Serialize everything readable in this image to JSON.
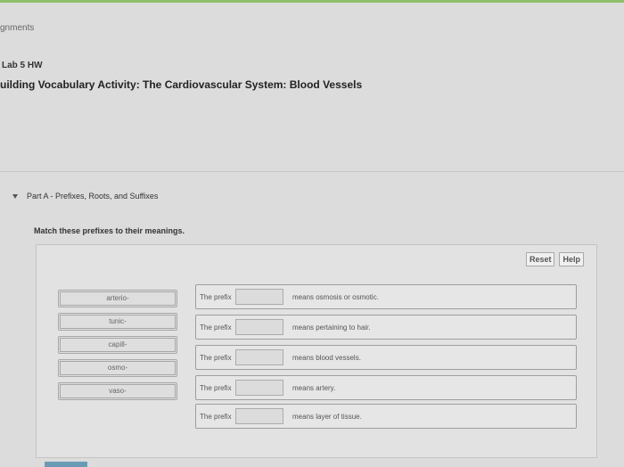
{
  "header": {
    "breadcrumb": "gnments",
    "lab": "Lab 5 HW",
    "title": "uilding Vocabulary Activity: The Cardiovascular System: Blood Vessels"
  },
  "part": {
    "label": "Part A - Prefixes, Roots, and Suffixes"
  },
  "instruction": "Match these prefixes to their meanings.",
  "tools": {
    "reset": "Reset",
    "help": "Help"
  },
  "chips": [
    "arterio-",
    "tunic-",
    "capill-",
    "osmo-",
    "vaso-"
  ],
  "rows": [
    {
      "prefix": "The prefix",
      "meaning": "means osmosis or osmotic."
    },
    {
      "prefix": "The prefix",
      "meaning": "means pertaining to hair."
    },
    {
      "prefix": "The prefix",
      "meaning": "means blood vessels."
    },
    {
      "prefix": "The prefix",
      "meaning": "means artery."
    },
    {
      "prefix": "The prefix",
      "meaning": "means layer of tissue."
    }
  ],
  "colors": {
    "accent_rule": "#8fbf6b",
    "bottom_bar": "#6a9bb5"
  }
}
